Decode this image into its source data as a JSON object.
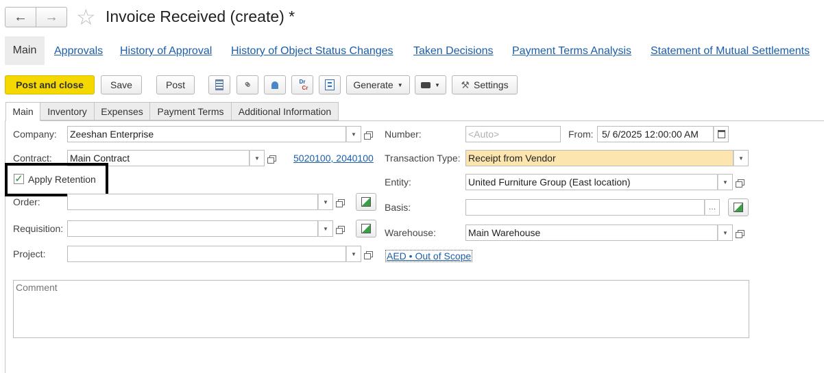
{
  "header": {
    "title": "Invoice Received (create) *"
  },
  "sections": {
    "main": "Main",
    "links": [
      "Approvals",
      "History of Approval",
      "History of Object Status Changes",
      "Taken Decisions",
      "Payment Terms Analysis",
      "Statement of Mutual Settlements"
    ]
  },
  "toolbar": {
    "post_and_close": "Post and close",
    "save": "Save",
    "post": "Post",
    "generate": "Generate",
    "settings": "Settings",
    "primary_color": "#f5d800"
  },
  "tabs": [
    "Main",
    "Inventory",
    "Expenses",
    "Payment Terms",
    "Additional Information"
  ],
  "form": {
    "company": {
      "label": "Company:",
      "value": "Zeeshan Enterprise"
    },
    "contract": {
      "label": "Contract:",
      "value": "Main Contract",
      "accounts": "5020100, 2040100"
    },
    "apply_retention": {
      "label": "Apply Retention",
      "checked": true
    },
    "order": {
      "label": "Order:",
      "value": ""
    },
    "requisition": {
      "label": "Requisition:",
      "value": ""
    },
    "project": {
      "label": "Project:",
      "value": ""
    },
    "number": {
      "label": "Number:",
      "placeholder": "<Auto>"
    },
    "from": {
      "label": "From:",
      "value": "5/ 6/2025 12:00:00 AM"
    },
    "transaction_type": {
      "label": "Transaction Type:",
      "value": "Receipt from Vendor",
      "highlight": "#fde5b0"
    },
    "entity": {
      "label": "Entity:",
      "value": "United Furniture Group (East location)"
    },
    "basis": {
      "label": "Basis:",
      "value": ""
    },
    "warehouse": {
      "label": "Warehouse:",
      "value": "Main Warehouse"
    },
    "currency_tax": "AED • Out of Scope",
    "comment": {
      "placeholder": "Comment"
    }
  }
}
